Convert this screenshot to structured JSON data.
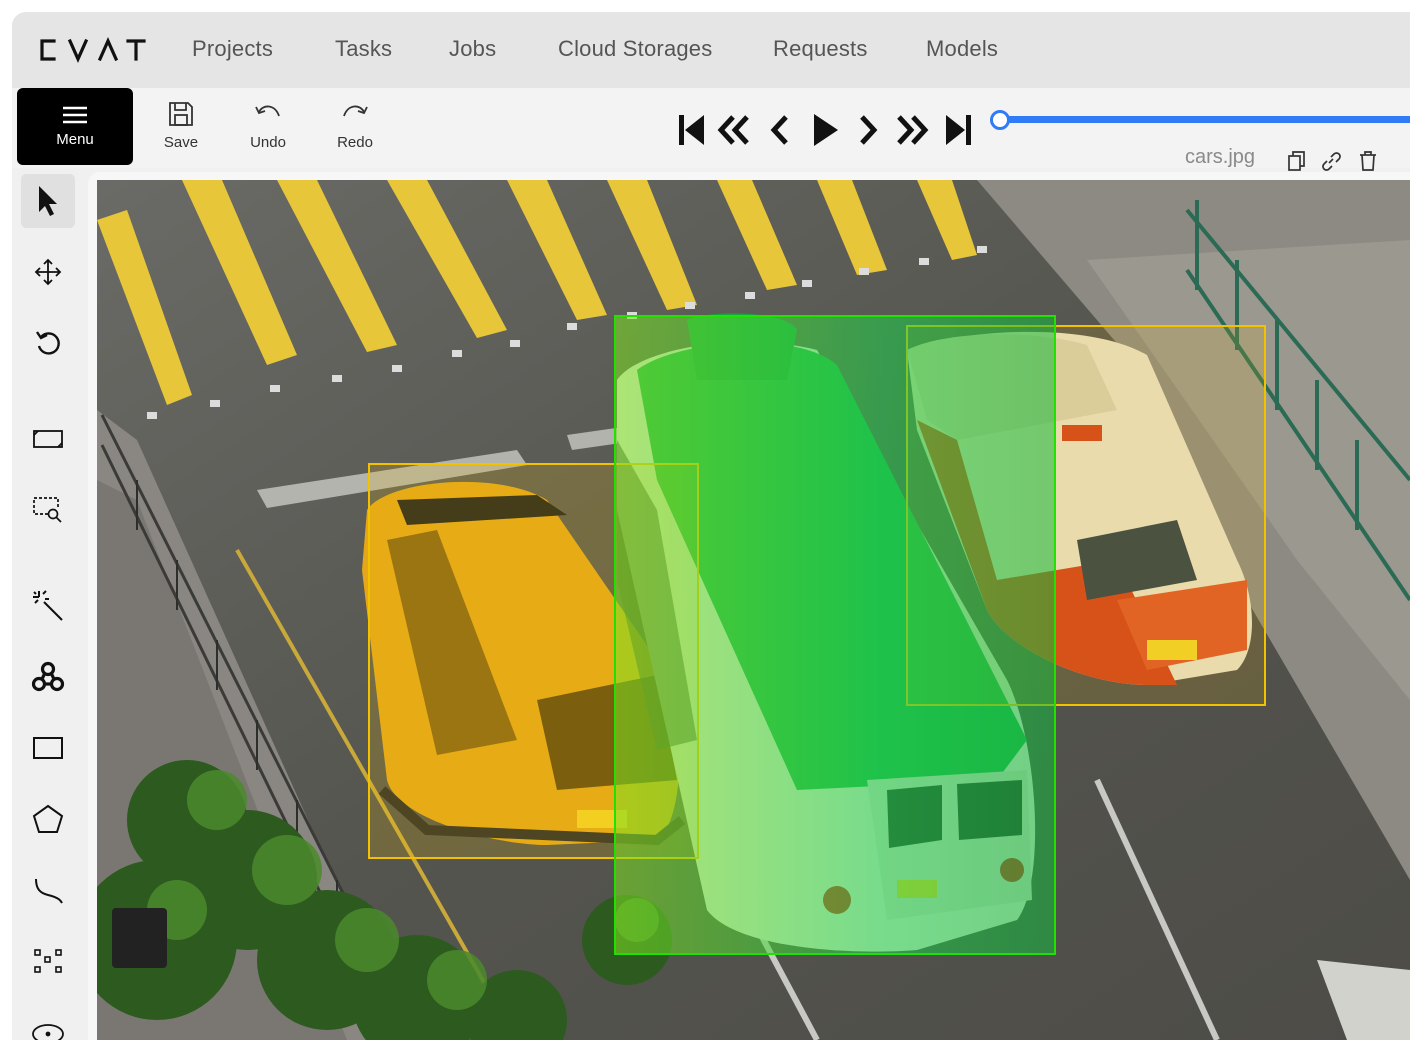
{
  "app": {
    "logo_text": "CVAT"
  },
  "nav": {
    "items": [
      {
        "label": "Projects"
      },
      {
        "label": "Tasks"
      },
      {
        "label": "Jobs"
      },
      {
        "label": "Cloud Storages"
      },
      {
        "label": "Requests"
      },
      {
        "label": "Models"
      }
    ]
  },
  "toolbar": {
    "menu_label": "Menu",
    "save_label": "Save",
    "undo_label": "Undo",
    "redo_label": "Redo"
  },
  "player": {
    "buttons": [
      "first-frame",
      "back-fast",
      "previous",
      "play",
      "next",
      "forward-fast",
      "last-frame"
    ],
    "progress": 0.0,
    "filename": "cars.jpg"
  },
  "file_actions": [
    "copy-icon",
    "link-icon",
    "delete-icon"
  ],
  "tools": [
    {
      "name": "cursor-icon",
      "active": true
    },
    {
      "name": "move-icon"
    },
    {
      "name": "rotate-icon"
    },
    {
      "name": "fit-image-icon"
    },
    {
      "name": "zoom-region-icon"
    },
    {
      "name": "magic-wand-icon"
    },
    {
      "name": "ai-tools-icon"
    },
    {
      "name": "rectangle-icon"
    },
    {
      "name": "polygon-icon"
    },
    {
      "name": "polyline-icon"
    },
    {
      "name": "points-icon"
    },
    {
      "name": "ellipse-icon"
    }
  ],
  "annotations": [
    {
      "label_color": "#f2c200",
      "object": "yellow-car"
    },
    {
      "label_color": "#22e000",
      "object": "green-minibus"
    },
    {
      "label_color": "#f2c200",
      "object": "taxi"
    }
  ],
  "colors": {
    "accent": "#2f7cf6",
    "menu_bg": "#000000"
  }
}
